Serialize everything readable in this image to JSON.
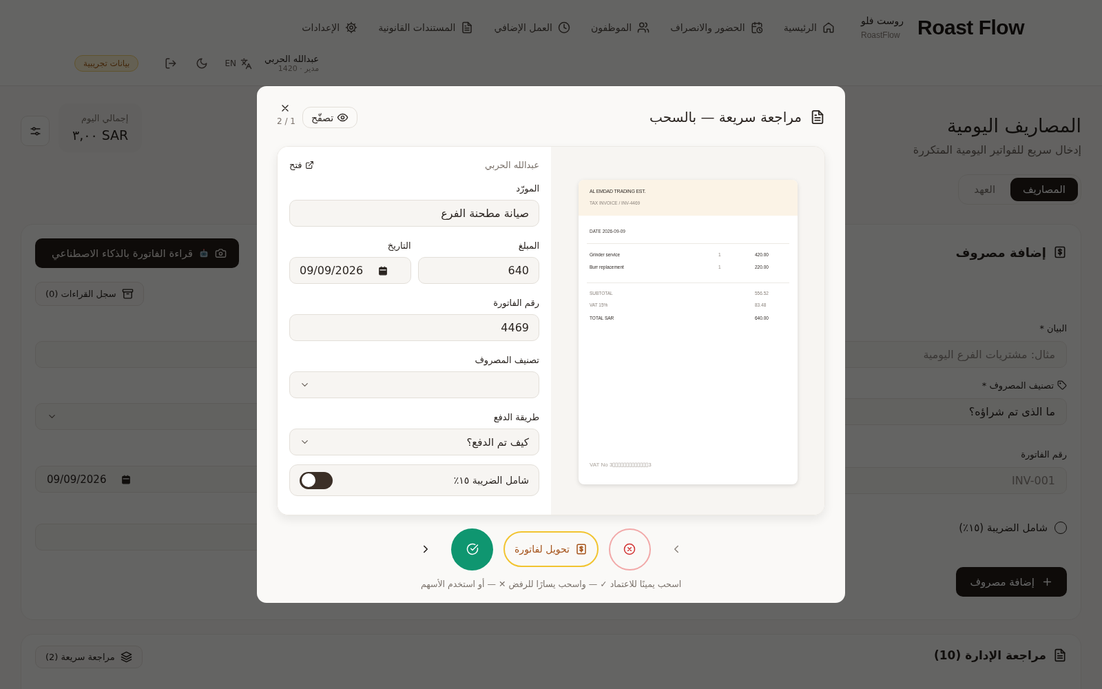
{
  "header": {
    "logo": "Roast Flow",
    "brand_ar": "روست فلو",
    "brand_en": "RoastFlow",
    "nav": [
      {
        "label": "الرئيسية"
      },
      {
        "label": "الحضور والانصراف"
      },
      {
        "label": "الموظفون"
      },
      {
        "label": "العمل الإضافي"
      },
      {
        "label": "المستندات القانونية"
      },
      {
        "label": "الإعدادات"
      }
    ],
    "user": {
      "name": "عبدالله الحربي",
      "role": "مدير · 1420"
    },
    "language": "EN",
    "demo_badge": "بيانات تجريبية"
  },
  "page": {
    "title": "المصاريف اليومية",
    "subtitle": "إدخال سريع للفواتير اليومية المتكررة",
    "tabs": [
      {
        "label": "المصاريف",
        "selected": true
      },
      {
        "label": "العهد",
        "selected": false
      }
    ],
    "stats": {
      "label": "إجمالي اليوم",
      "value": "٣,٠٠ SAR"
    }
  },
  "expense_form": {
    "title": "إضافة مصروف",
    "ai_button": "قراءة الفاتورة بالذكاء الاصطناعي",
    "history_button": "سجل القراءات (0)",
    "fields": [
      {
        "label": "البيان *",
        "placeholder": "مثال: مشتريات الفرع اليومية"
      },
      {
        "label": "تصنيف المصروف *",
        "value": "ما الذى تم شراؤه؟"
      },
      {
        "label": "رقم الفاتورة",
        "placeholder": "INV-001"
      }
    ],
    "side_fields": [
      {
        "kind": "text"
      },
      {
        "kind": "select"
      },
      {
        "kind": "date",
        "value": "09/09/2026"
      },
      {
        "kind": "text"
      }
    ],
    "tax_radio": {
      "label": "شامل الضريبة (١٥٪)",
      "checked": false
    },
    "submit": "إضافة مصروف"
  },
  "review_section": {
    "title": "مراجعة الإدارة (10)",
    "quick_review_button": "مراجعة سريعة (2)"
  },
  "modal": {
    "title": "مراجعة سريعة — بالسحب",
    "browse_button": "تصفّح",
    "counter": "2 / 1",
    "submitter": "عبدالله الحربي",
    "open_link": "فتح",
    "supplier": {
      "label": "المورّد",
      "value": "صيانة مطحنة الفرع"
    },
    "amount": {
      "label": "المبلغ",
      "value": "640"
    },
    "date": {
      "label": "التاريخ",
      "value": "09/09/2026"
    },
    "invoice_number": {
      "label": "رقم الفاتورة",
      "value": "4469"
    },
    "category": {
      "label": "تصنيف المصروف"
    },
    "payment_method": {
      "label": "طريقة الدفع",
      "value": "كيف تم الدفع؟"
    },
    "tax_toggle": {
      "label": "شامل الضريبة ١٥٪",
      "on": false
    },
    "invoice": {
      "company": "AL EMDAD TRADING EST.",
      "subtitle": "TAX INVOICE / INV-4469",
      "date": "DATE 2026-09-09",
      "items": [
        {
          "name": "Grinder service",
          "qty": "1",
          "amount": "420.00"
        },
        {
          "name": "Burr replacement",
          "qty": "1",
          "amount": "220.00"
        }
      ],
      "totals": [
        {
          "label": "SUBTOTAL",
          "value": "556.52",
          "kind": "sub"
        },
        {
          "label": "VAT 15%",
          "value": "83.48",
          "kind": "sub"
        },
        {
          "label": "TOTAL SAR",
          "value": "640.00",
          "kind": "total"
        }
      ],
      "vat_no": "VAT No 3▯▯▯▯▯▯▯▯▯▯▯▯▯3"
    },
    "convert_button": "تحويل لفاتورة",
    "hint": "اسحب يمينًا للاعتماد ✓ — واسحب يسارًا للرفض ✕ — أو استخدم الأسهم"
  }
}
